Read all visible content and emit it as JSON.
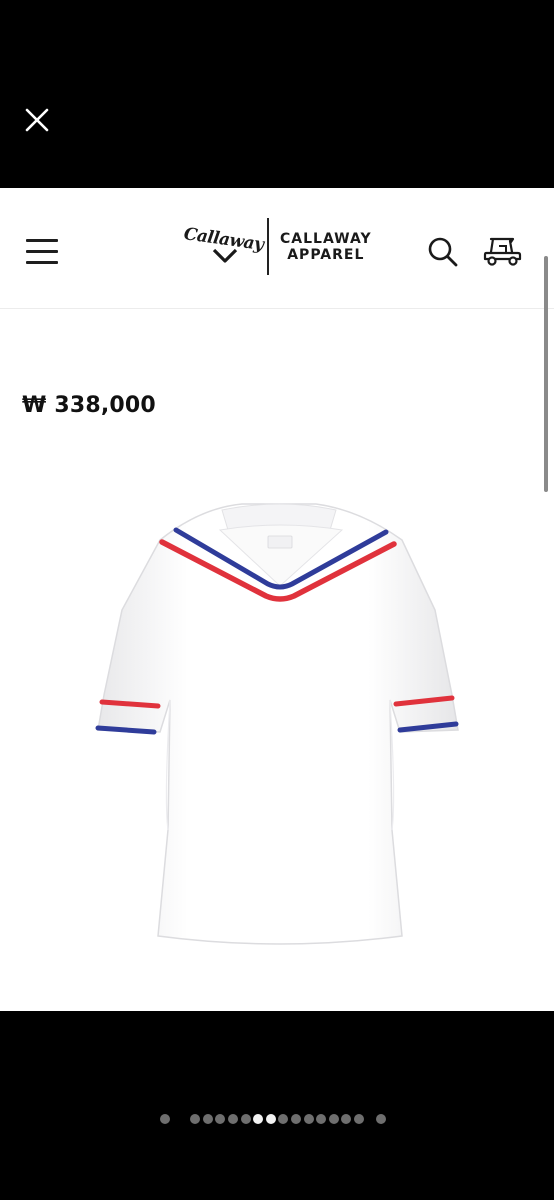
{
  "top_bar": {
    "close_icon": "close-icon"
  },
  "header": {
    "menu_icon": "hamburger-menu-icon",
    "logo": {
      "script": "Callaway",
      "line1": "CALLAWAY",
      "line2": "APPAREL"
    },
    "search_icon": "search-icon",
    "cart_icon": "golf-cart-icon"
  },
  "product": {
    "price": "₩ 338,000",
    "image": "white-knit-top-with-red-blue-sailor-collar",
    "colors": {
      "red": "#e0323c",
      "blue": "#2f3c9a",
      "shirt": "#ffffff"
    }
  },
  "pager": {
    "count": 16,
    "active_indices": [
      6,
      7
    ]
  }
}
